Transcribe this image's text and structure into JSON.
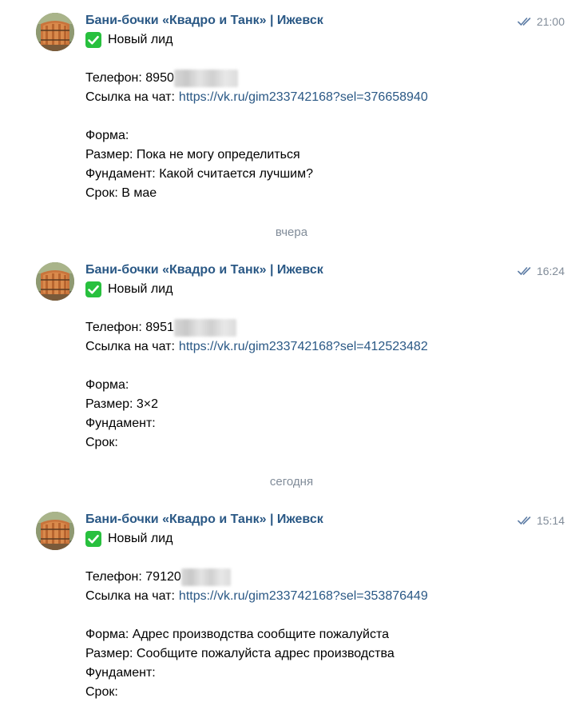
{
  "colors": {
    "sender": "#2a5885",
    "link": "#2a5885",
    "meta": "#818c99",
    "check_badge": "#28c03e"
  },
  "messages": [
    {
      "sender": "Бани-бочки «Квадро и Танк» | Ижевск",
      "time": "21:00",
      "read_icon": "double-check-icon",
      "status_icon": "green-checkmark-icon",
      "status": "Новый лид",
      "phone_label": "Телефон:",
      "phone_value": "8950",
      "chat_label": "Ссылка на чат:",
      "chat_url": "https://vk.ru/gim233742168?sel=376658940",
      "form_label": "Форма:",
      "form_value": "",
      "size_label": "Размер:",
      "size_value": "Пока не могу определиться",
      "foundation_label": "Фундамент:",
      "foundation_value": "Какой считается лучшим?",
      "term_label": "Срок:",
      "term_value": "В мае"
    },
    {
      "sender": "Бани-бочки «Квадро и Танк» | Ижевск",
      "time": "16:24",
      "read_icon": "double-check-icon",
      "status_icon": "green-checkmark-icon",
      "status": "Новый лид",
      "phone_label": "Телефон:",
      "phone_value": "8951",
      "chat_label": "Ссылка на чат:",
      "chat_url": "https://vk.ru/gim233742168?sel=412523482",
      "form_label": "Форма:",
      "form_value": "",
      "size_label": "Размер:",
      "size_value": "3×2",
      "foundation_label": "Фундамент:",
      "foundation_value": "",
      "term_label": "Срок:",
      "term_value": ""
    },
    {
      "sender": "Бани-бочки «Квадро и Танк» | Ижевск",
      "time": "15:14",
      "read_icon": "double-check-icon",
      "status_icon": "green-checkmark-icon",
      "status": "Новый лид",
      "phone_label": "Телефон:",
      "phone_value": "79120",
      "chat_label": "Ссылка на чат:",
      "chat_url": "https://vk.ru/gim233742168?sel=353876449",
      "form_label": "Форма:",
      "form_value": "Адрес производства сообщите пожалуйста",
      "size_label": "Размер:",
      "size_value": "Сообщите пожалуйста адрес производства",
      "foundation_label": "Фундамент:",
      "foundation_value": "",
      "term_label": "Срок:",
      "term_value": ""
    }
  ],
  "date_separators": [
    "вчера",
    "сегодня"
  ]
}
